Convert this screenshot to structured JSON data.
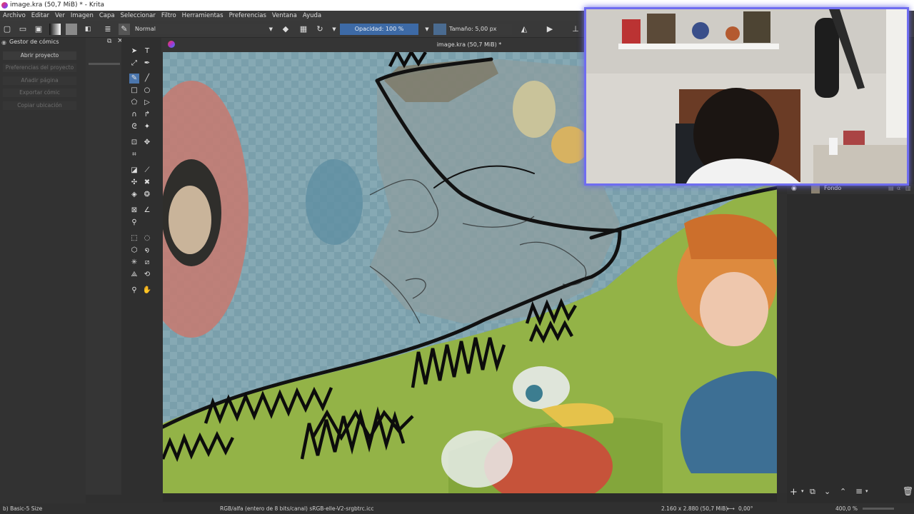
{
  "window": {
    "title": "image.kra (50,7 MiB) * - Krita"
  },
  "menu": [
    "Archivo",
    "Editar",
    "Ver",
    "Imagen",
    "Capa",
    "Seleccionar",
    "Filtro",
    "Herramientas",
    "Preferencias",
    "Ventana",
    "Ayuda"
  ],
  "tool_options": {
    "blend_mode": "Normal",
    "opacity": "Opacidad: 100 %",
    "size": "Tamaño: 5,00 px"
  },
  "comic_manager": {
    "title": "Gestor de cómics",
    "buttons": [
      {
        "label": "Abrir proyecto",
        "enabled": true
      },
      {
        "label": "Preferencias del proyecto",
        "enabled": false
      },
      {
        "label": "Añadir página",
        "enabled": false
      },
      {
        "label": "Exportar cómic",
        "enabled": false
      },
      {
        "label": "Copiar ubicación",
        "enabled": false
      }
    ]
  },
  "document": {
    "tab_title": "image.kra (50,7 MiB) *"
  },
  "layers": {
    "items": [
      {
        "name": "Fondo"
      }
    ]
  },
  "status": {
    "brush": "b) Basic-5 Size",
    "color_space": "RGB/alfa (entero de 8 bits/canal)  sRGB-elle-V2-srgbtrc.icc",
    "dimensions": "2.160 x 2.880 (50,7 MiB)",
    "rotation": "0,00°",
    "zoom": "400,0 %"
  },
  "colors": {
    "accent": "#4b76ad",
    "opacity_slider": "#3d6aa6",
    "webcam_border": "#6f6df0"
  }
}
